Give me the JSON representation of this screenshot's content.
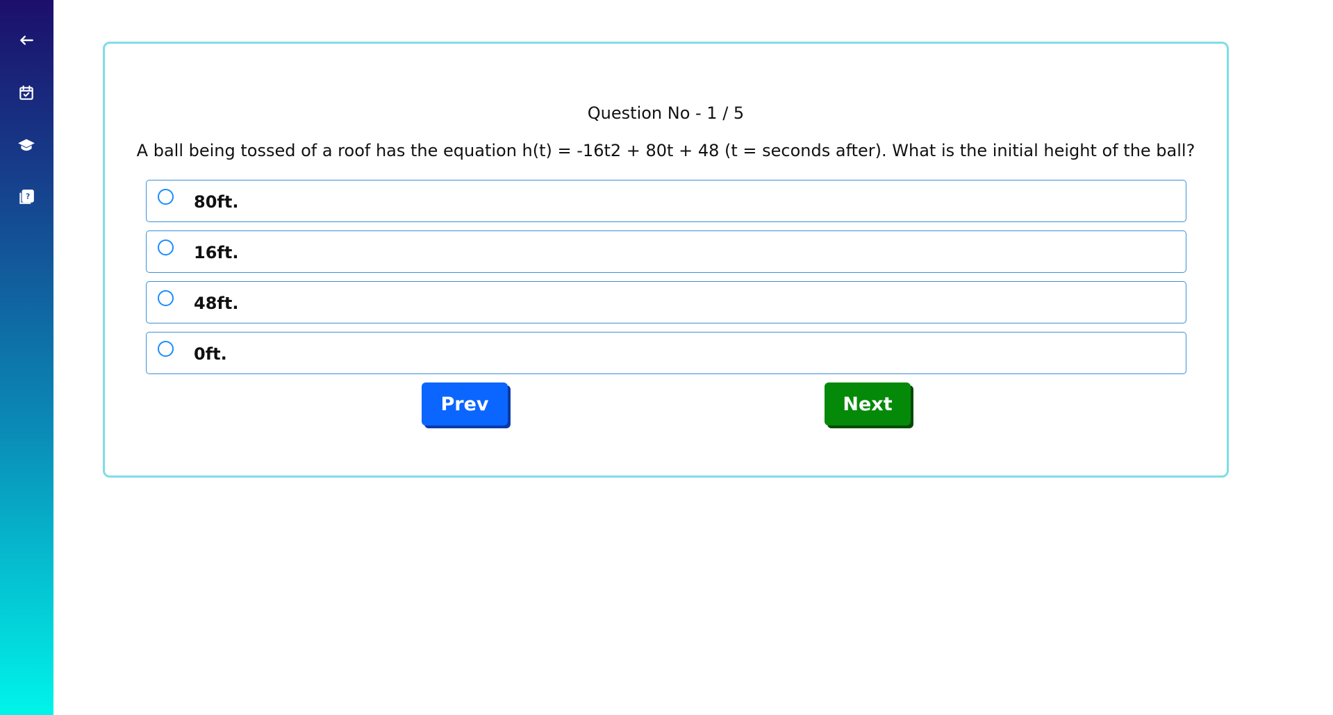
{
  "sidebar": {
    "items": [
      {
        "name": "back-icon"
      },
      {
        "name": "calendar-check-icon"
      },
      {
        "name": "graduation-cap-icon"
      },
      {
        "name": "question-book-icon"
      }
    ]
  },
  "quiz": {
    "question_number": "Question No - 1 / 5",
    "question_text": "A ball being tossed of a roof has the equation h(t) = -16t2 + 80t + 48 (t = seconds after). What is the initial height of the ball?",
    "options": [
      {
        "label": "80ft."
      },
      {
        "label": "16ft."
      },
      {
        "label": "48ft."
      },
      {
        "label": "0ft."
      }
    ],
    "prev_label": "Prev",
    "next_label": "Next"
  },
  "colors": {
    "card_border": "#7fdde6",
    "option_border": "#3a8fd6",
    "prev_button": "#0a66ff",
    "next_button": "#048a08"
  }
}
